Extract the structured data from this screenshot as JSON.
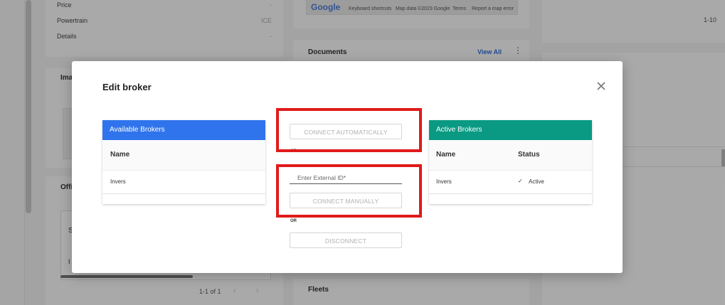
{
  "background": {
    "details_rows": [
      {
        "label": "Price",
        "value": "-"
      },
      {
        "label": "Powertrain",
        "value": "ICE"
      },
      {
        "label": "Details",
        "value": "-"
      }
    ],
    "images_title_fragment": "Ima",
    "offers_title_fragment": "Offi",
    "table_cell_fragment_1": "S",
    "table_cell_fragment_2": "I",
    "pager_left": "1-1 of 1",
    "pager_right": "1-10",
    "map_logo": "Google",
    "map_shortcuts": "Keyboard shortcuts",
    "map_data": "Map data ©2023 Google",
    "map_terms": "Terms",
    "map_report": "Report a map error",
    "documents_title": "Documents",
    "documents_link": "View All",
    "fleets_title": "Fleets"
  },
  "modal": {
    "title": "Edit broker",
    "available": {
      "header": "Available Brokers",
      "col_name": "Name",
      "rows": [
        {
          "name": "Invers"
        }
      ]
    },
    "active": {
      "header": "Active Brokers",
      "col_name": "Name",
      "col_status": "Status",
      "rows": [
        {
          "name": "Invers",
          "status": "Active"
        }
      ]
    },
    "actions": {
      "connect_auto": "CONNECT AUTOMATICALLY",
      "or_1": "OR",
      "external_id_placeholder": "Enter External ID*",
      "connect_manual": "CONNECT MANUALLY",
      "or_2": "OR",
      "disconnect": "DISCONNECT"
    }
  },
  "colors": {
    "available_header": "#2f74ec",
    "active_header": "#0a9a83",
    "highlight": "#e11a1a",
    "link": "#2f6fd6"
  }
}
